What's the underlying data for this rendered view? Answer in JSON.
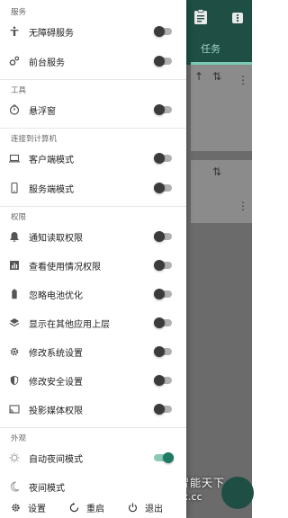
{
  "background": {
    "tab_label": "任务",
    "watermark_text": "八神智能天下",
    "watermark_url": "znzx.cc"
  },
  "sections": {
    "service": {
      "title": "服务"
    },
    "tools": {
      "title": "工具"
    },
    "connect": {
      "title": "连接到计算机"
    },
    "permissions": {
      "title": "权限"
    },
    "appearance": {
      "title": "外观"
    }
  },
  "rows": {
    "accessibility": {
      "label": "无障碍服务",
      "on": false
    },
    "foreground": {
      "label": "前台服务",
      "on": false
    },
    "floating": {
      "label": "悬浮窗",
      "on": false
    },
    "client_mode": {
      "label": "客户端模式",
      "on": false
    },
    "server_mode": {
      "label": "服务端模式",
      "on": false
    },
    "notification_read": {
      "label": "通知读取权限",
      "on": false
    },
    "usage_stats": {
      "label": "查看使用情况权限",
      "on": false
    },
    "battery_opt": {
      "label": "忽略电池优化",
      "on": false
    },
    "overlay": {
      "label": "显示在其他应用上层",
      "on": false
    },
    "write_settings": {
      "label": "修改系统设置",
      "on": false
    },
    "secure_settings": {
      "label": "修改安全设置",
      "on": false
    },
    "media_projection": {
      "label": "投影媒体权限",
      "on": false
    },
    "auto_night": {
      "label": "自动夜间模式",
      "on": true
    },
    "night_mode": {
      "label": "夜间模式"
    }
  },
  "bottom_bar": {
    "settings": "设置",
    "restart": "重启",
    "exit": "退出"
  },
  "colors": {
    "accent": "#1e7a62",
    "toolbar": "#1f4f44"
  }
}
